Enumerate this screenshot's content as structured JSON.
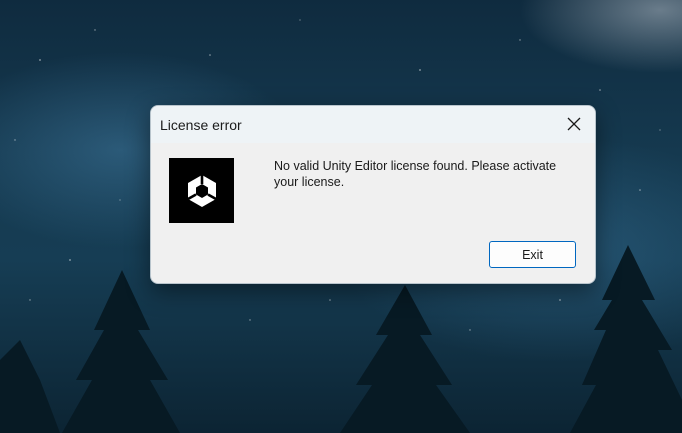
{
  "dialog": {
    "title": "License error",
    "message": "No valid Unity Editor license found. Please activate your license.",
    "exit_label": "Exit"
  },
  "icons": {
    "close": "close-icon",
    "logo": "unity-logo-icon"
  },
  "colors": {
    "accent": "#0067c0",
    "dialog_bg": "#f0f0f0",
    "titlebar_bg": "#eef3f6",
    "logo_bg": "#000000"
  }
}
